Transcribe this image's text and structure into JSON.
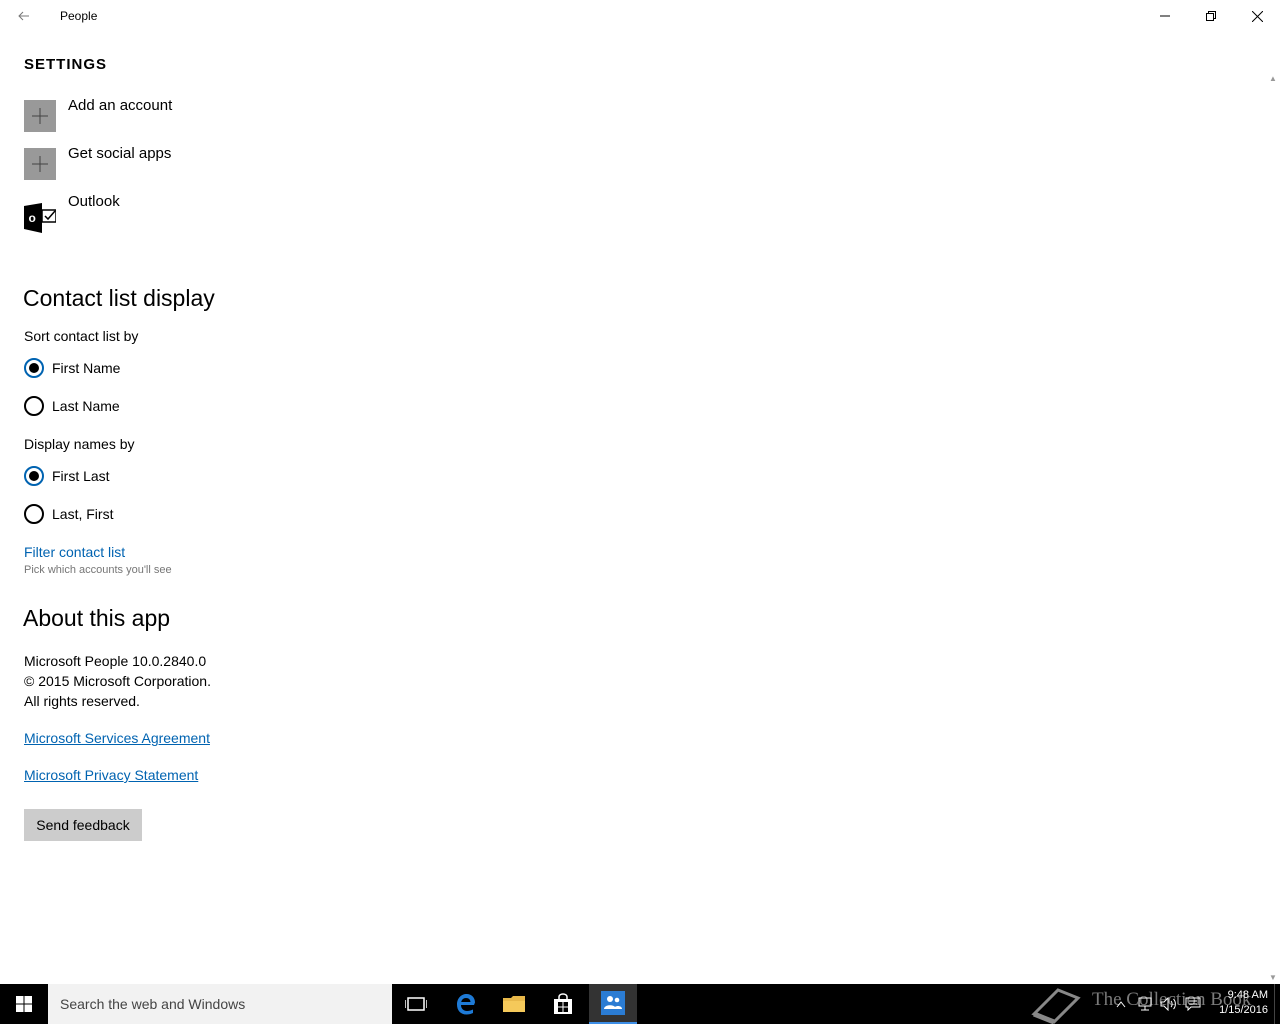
{
  "window": {
    "title": "People"
  },
  "settings": {
    "header": "SETTINGS",
    "accounts": [
      {
        "label": "Add an account",
        "icon": "plus-icon"
      },
      {
        "label": "Get social apps",
        "icon": "plus-icon"
      },
      {
        "label": "Outlook",
        "icon": "outlook-icon"
      }
    ]
  },
  "contact_display": {
    "title": "Contact list display",
    "sort_label": "Sort contact list by",
    "sort_options": [
      {
        "label": "First Name",
        "checked": true
      },
      {
        "label": "Last Name",
        "checked": false
      }
    ],
    "display_label": "Display names by",
    "display_options": [
      {
        "label": "First Last",
        "checked": true
      },
      {
        "label": "Last, First",
        "checked": false
      }
    ],
    "filter_link": "Filter contact list",
    "filter_caption": "Pick which accounts you'll see"
  },
  "about": {
    "title": "About this app",
    "version": "Microsoft People 10.0.2840.0",
    "copyright": "© 2015 Microsoft Corporation.",
    "rights": "All rights reserved.",
    "services_link": "Microsoft Services Agreement",
    "privacy_link": "Microsoft Privacy Statement",
    "feedback_button": "Send feedback"
  },
  "taskbar": {
    "search_placeholder": "Search the web and Windows",
    "watermark": "The Collection Book",
    "time": "9:48 AM",
    "date": "1/15/2016"
  },
  "colors": {
    "accent": "#0063b1",
    "icon_gray": "#999999",
    "taskbar": "#000000"
  }
}
